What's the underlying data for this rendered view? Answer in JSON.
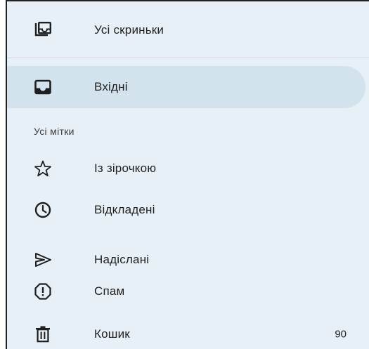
{
  "nav": {
    "all_inboxes": {
      "label": "Усі скриньки",
      "icon": "all-inboxes-icon"
    },
    "inbox": {
      "label": "Вхідні",
      "icon": "inbox-icon",
      "selected": true
    },
    "section_header": "Усі мітки",
    "starred": {
      "label": "Із зірочкою",
      "icon": "star-icon"
    },
    "snoozed": {
      "label": "Відкладені",
      "icon": "clock-icon"
    },
    "sent": {
      "label": "Надіслані",
      "icon": "send-icon"
    },
    "spam": {
      "label": "Спам",
      "icon": "report-icon"
    },
    "trash": {
      "label": "Кошик",
      "icon": "trash-icon",
      "count": "90"
    }
  },
  "colors": {
    "background": "#e6f0f6",
    "selected": "#d3e3ee",
    "text": "#1f1f1f"
  }
}
